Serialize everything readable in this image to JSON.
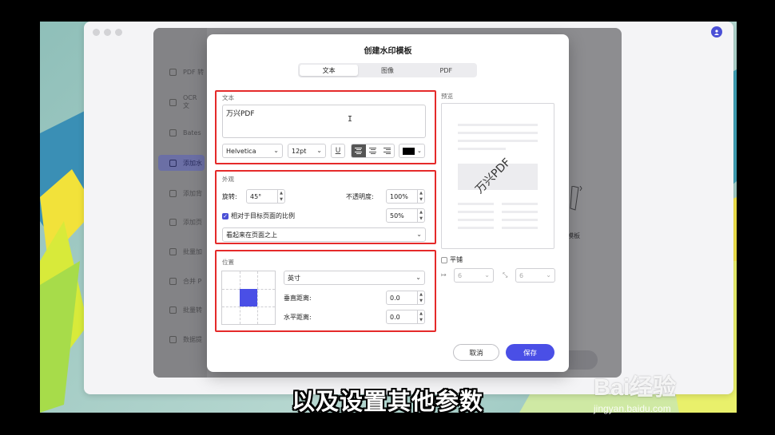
{
  "dialog": {
    "title": "创建水印模板",
    "tabs": [
      "文本",
      "图像",
      "PDF"
    ],
    "text_section": {
      "label": "文本",
      "content": "万兴PDF",
      "font": "Helvetica",
      "size": "12pt",
      "underline_label": "U",
      "color": "#000000"
    },
    "appearance": {
      "label": "外观",
      "rotation_label": "旋转:",
      "rotation_value": "45°",
      "opacity_label": "不透明度:",
      "opacity_value": "100%",
      "relative_label": "相对于目标页面的比例",
      "relative_checked": true,
      "relative_value": "50%",
      "layer_value": "看起来在页面之上"
    },
    "position": {
      "label": "位置",
      "unit": "英寸",
      "vertical_label": "垂直距离:",
      "vertical_value": "0.0",
      "horizontal_label": "水平距离:",
      "horizontal_value": "0.0"
    },
    "preview": {
      "label": "预览",
      "watermark_text": "万兴PDF",
      "tile_label": "平铺",
      "tile_checked": false,
      "tile_h": "6",
      "tile_v": "6"
    },
    "buttons": {
      "cancel": "取消",
      "save": "保存"
    }
  },
  "background_app": {
    "sidebar_items": [
      "PDF 转",
      "OCR 文",
      "Bates",
      "添加水",
      "添加背",
      "添加页",
      "批量加",
      "合并 P",
      "批量转",
      "数据提"
    ],
    "active_index": 3,
    "right_panel_label": "模板"
  },
  "accent_color": "#4a4fe6",
  "caption": "以及设置其他参数",
  "watermark": {
    "brand": "Bai经验",
    "url": "jingyan.baidu.com"
  }
}
